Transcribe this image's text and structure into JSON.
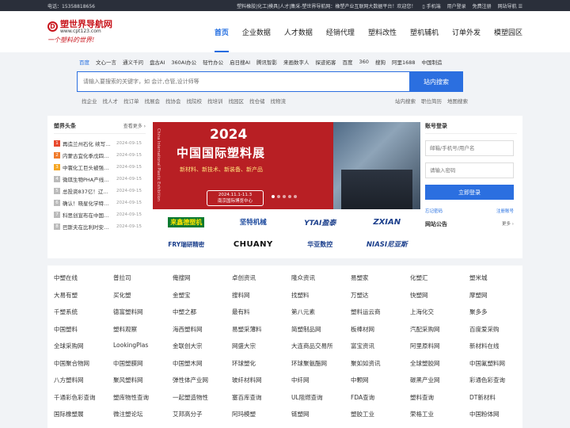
{
  "topbar": {
    "phone": "电话：15358818656",
    "notice": "塑料橡胶|化工|模具|人才|集采-塑世界导航网：橡塑产业互联网大数据平台！欢迎您！",
    "mobile": "手机端",
    "user_login": "用户登录",
    "register": "免费注册",
    "sitenav": "网站导航"
  },
  "logo": {
    "name": "塑世界导航网",
    "url": "www.cpt123.com",
    "slogan": "一个塑料的世界!"
  },
  "nav": [
    "首页",
    "企业数据",
    "人才数据",
    "经销代理",
    "塑料改性",
    "塑机辅机",
    "订单外发",
    "模塑园区"
  ],
  "engines": [
    "百度",
    "文心一言",
    "通义千问",
    "盘古AI",
    "360AI办公",
    "轻竹办公",
    "启日搜AI",
    "腾讯智影",
    "来画数字人",
    "探迹拓客",
    "百度",
    "360",
    "搜狗",
    "阿里1688",
    "中国制造"
  ],
  "search": {
    "placeholder": "请输入要搜索的关键字，如 会计,仓管,设计师等",
    "button": "站内搜索"
  },
  "sublinks_left": [
    "找企业",
    "找人才",
    "找订单",
    "找展会",
    "找协会",
    "找院校",
    "找培训",
    "找园区",
    "找仓储",
    "找物流"
  ],
  "sublinks_right": [
    "站内搜索",
    "职位简历",
    "地图搜索"
  ],
  "news": {
    "title": "塑界头条",
    "more": "查看更多 ›",
    "items": [
      {
        "num": "1",
        "title": "再造兰州石化 续写…",
        "date": "2024-09-15",
        "color": "#e8482c"
      },
      {
        "num": "2",
        "title": "内蒙古宜化季戊四…",
        "date": "2024-09-15",
        "color": "#f07b2b"
      },
      {
        "num": "3",
        "title": "中寰化工巨头被强…",
        "date": "2024-09-15",
        "color": "#f5a623"
      },
      {
        "num": "4",
        "title": "微琪生物PHA产线…",
        "date": "2024-09-15",
        "color": "#bbbbbb"
      },
      {
        "num": "5",
        "title": "总投资837亿！辽…",
        "date": "2024-09-15",
        "color": "#bbbbbb"
      },
      {
        "num": "6",
        "title": "确认！晓星化学特…",
        "date": "2024-09-15",
        "color": "#bbbbbb"
      },
      {
        "num": "7",
        "title": "科思创宣布在中国…",
        "date": "2024-09-15",
        "color": "#bbbbbb"
      },
      {
        "num": "8",
        "title": "巴斯夫在比利时安…",
        "date": "2024-09-15",
        "color": "#bbbbbb"
      }
    ]
  },
  "banner": {
    "year": "2024",
    "title": "中国国际塑料展",
    "subtitle": "新材料、新技术、新装备、新产品",
    "dates": "2024.11.1-11.3",
    "venue": "南京国际博览中心",
    "side_text": "China International Plastic Exhibition"
  },
  "brands": [
    "来鑫德塑机",
    "坚特机械",
    "YTAI盈泰",
    "ZXIAN",
    "FRY瑞研精密",
    "CHUANY",
    "华亚数控",
    "NIASI尼亚斯"
  ],
  "login": {
    "title": "账号登录",
    "email_placeholder": "邮箱/手机号/用户名",
    "password_placeholder": "请输入密码",
    "button": "立即登录",
    "forgot": "忘记密码",
    "register": "注册账号",
    "notice_title": "网站公告",
    "notice_more": "更多 ›"
  },
  "links": [
    "中塑在线",
    "普拉司",
    "俺搜网",
    "卓创资讯",
    "隆众资讯",
    "易塑家",
    "化塑汇",
    "塑米城",
    "大易有塑",
    "买化塑",
    "金塑宝",
    "搜料网",
    "找塑料",
    "万塑达",
    "快塑网",
    "摩塑网",
    "千塑系统",
    "德富塑料网",
    "中塑之都",
    "最有料",
    "第八元素",
    "塑料运云商",
    "上海化交",
    "聚多多",
    "中国塑料",
    "塑料观察",
    "海西塑料网",
    "易塑采薄料",
    "简塑制品网",
    "板棒材网",
    "汽配采购网",
    "百度爱采购",
    "全球采购网",
    "LookingPlas",
    "金联创大宗",
    "网盛大宗",
    "大连商品交易所",
    "富宝资讯",
    "阿里原料网",
    "新材料在线",
    "中国聚合物网",
    "中国塑膜网",
    "中国塑木网",
    "环球塑化",
    "环球聚氨酯网",
    "聚如如资讯",
    "全球塑胶网",
    "中国氟塑料网",
    "八方塑料网",
    "聚风塑料网",
    "弹性体产业网",
    "玻纤材料网",
    "中纤网",
    "中颗网",
    "碳黑产业网",
    "彩通色彩查询",
    "千通彩色彩查询",
    "塑库物性查询",
    "一起塑造物性",
    "塞百库查询",
    "UL阻燃查询",
    "FDA查询",
    "塑料查询",
    "DT新材料",
    "国际橡塑展",
    "微注塑论坛",
    "艾邦高分子",
    "阿玛模塑",
    "链塑网",
    "塑胶工业",
    "荣格工业",
    "中国粉体网"
  ]
}
